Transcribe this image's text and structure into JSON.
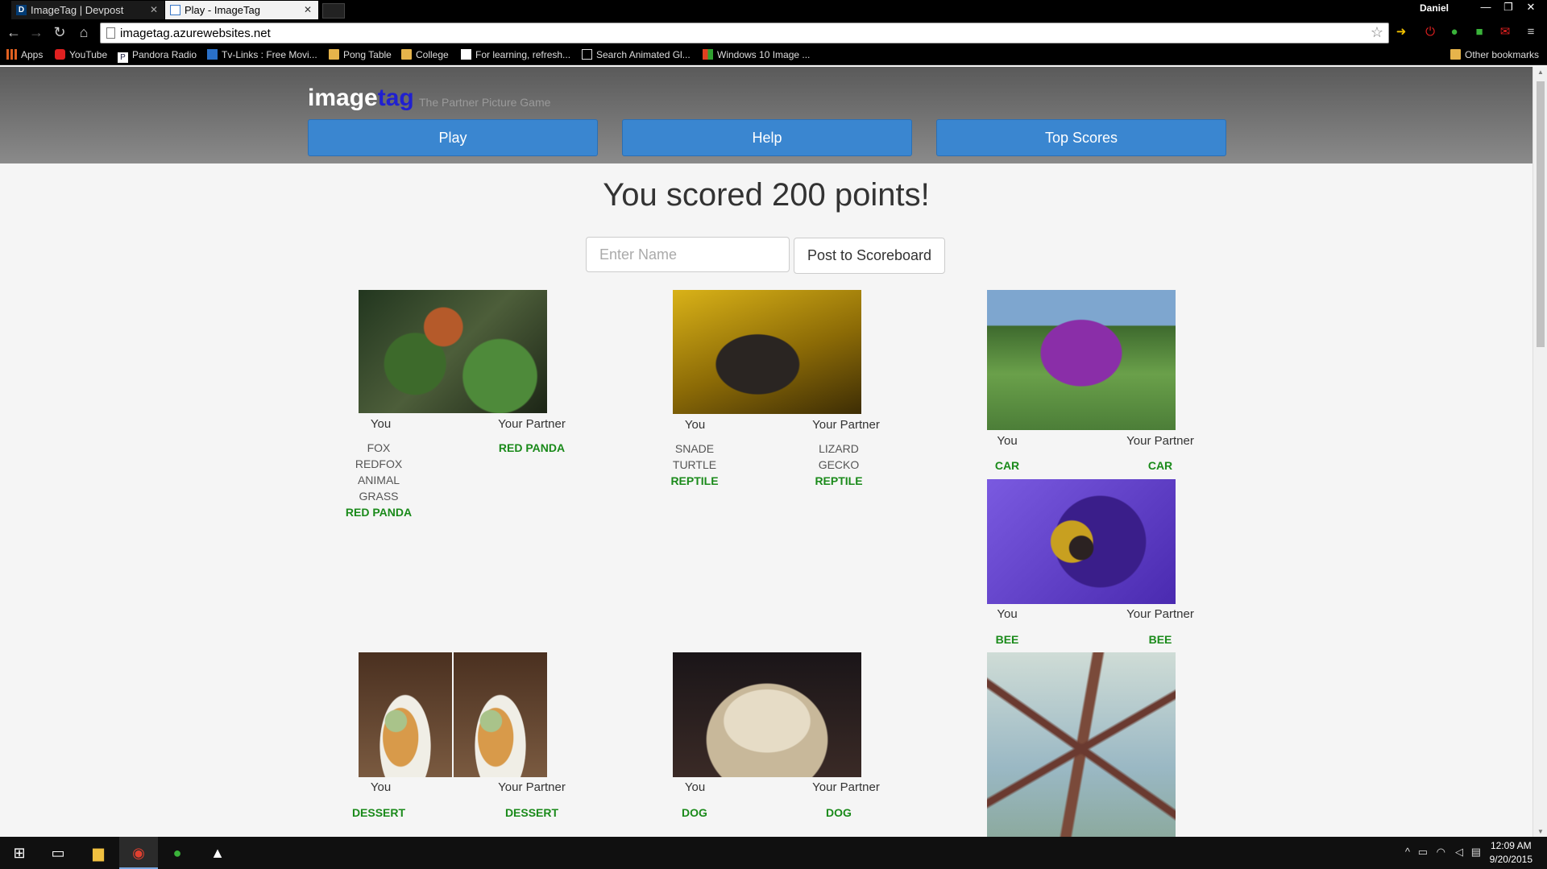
{
  "browser": {
    "tabs": [
      {
        "label": "ImageTag | Devpost",
        "favicon": "D",
        "active": false
      },
      {
        "label": "Play - ImageTag",
        "favicon": "",
        "active": true
      }
    ],
    "user": "Daniel",
    "url": "imagetag.azurewebsites.net",
    "bookmarks": [
      {
        "label": "Apps",
        "icon": "apps-grid-icon"
      },
      {
        "label": "YouTube",
        "icon": "youtube-icon"
      },
      {
        "label": "Pandora Radio",
        "icon": "pandora-icon"
      },
      {
        "label": "Tv-Links : Free Movi...",
        "icon": "tvlinks-icon"
      },
      {
        "label": "Pong Table",
        "icon": "folder-icon"
      },
      {
        "label": "College",
        "icon": "folder-icon"
      },
      {
        "label": "For learning, refresh...",
        "icon": "page-icon"
      },
      {
        "label": "Search Animated Gl...",
        "icon": "page-icon"
      },
      {
        "label": "Windows 10 Image ...",
        "icon": "windows-icon"
      }
    ],
    "other_bookmarks": "Other bookmarks"
  },
  "site": {
    "logo_image": "image",
    "logo_tag": "tag",
    "tagline": "The Partner Picture Game",
    "nav": {
      "play": "Play",
      "help": "Help",
      "top_scores": "Top Scores"
    }
  },
  "score": {
    "title": "You scored 200 points!",
    "name_placeholder": "Enter Name",
    "post_button": "Post to Scoreboard"
  },
  "labels": {
    "you": "You",
    "partner": "Your Partner"
  },
  "results": [
    {
      "image": "red-panda",
      "you": [
        "FOX",
        "REDFOX",
        "ANIMAL",
        "GRASS"
      ],
      "you_match": "RED PANDA",
      "partner": [],
      "partner_match": "RED PANDA"
    },
    {
      "image": "salamander",
      "you": [
        "SNADE",
        "TURTLE"
      ],
      "you_match": "REPTILE",
      "partner": [
        "LIZARD",
        "GECKO"
      ],
      "partner_match": "REPTILE"
    },
    {
      "image": "car",
      "you": [],
      "you_match": "CAR",
      "partner": [],
      "partner_match": "CAR"
    },
    {
      "image": "bee",
      "you": [],
      "you_match": "BEE",
      "partner": [],
      "partner_match": "BEE"
    },
    {
      "image": "dessert",
      "you": [],
      "you_match": "DESSERT",
      "partner": [],
      "partner_match": "DESSERT"
    },
    {
      "image": "dog",
      "you": [],
      "you_match": "DOG",
      "partner": [],
      "partner_match": "DOG"
    },
    {
      "image": "insect"
    }
  ],
  "taskbar": {
    "time": "12:09 AM",
    "date": "9/20/2015"
  },
  "colors": {
    "nav_button": "#3a86d0",
    "logo_tag": "#2020d0",
    "match_green": "#1a8a1a"
  }
}
